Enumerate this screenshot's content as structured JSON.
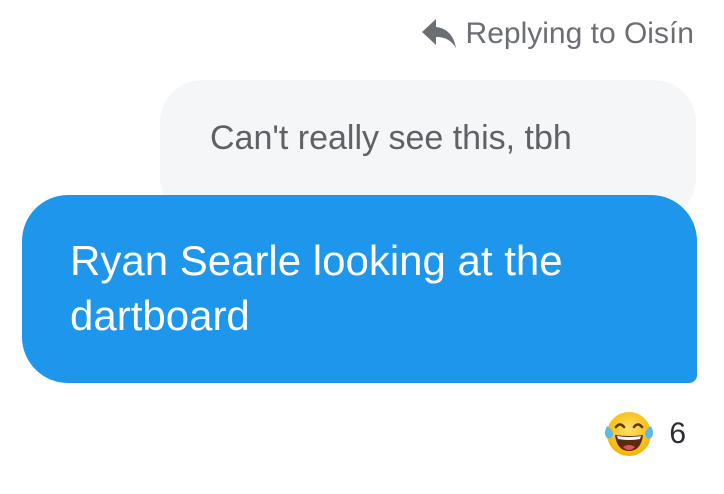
{
  "reply_header": {
    "icon": "reply-arrow-icon",
    "text": "Replying to Oisín"
  },
  "quoted_message": {
    "text": "Can't really see this, tbh"
  },
  "message": {
    "text": "Ryan Searle looking at the dartboard"
  },
  "reaction": {
    "icon": "face-with-tears-of-joy-icon",
    "count": "6"
  },
  "colors": {
    "bubble_blue": "#1d96ec",
    "quoted_bubble_bg": "#f5f6f8",
    "meta_text": "#6b6e73"
  }
}
